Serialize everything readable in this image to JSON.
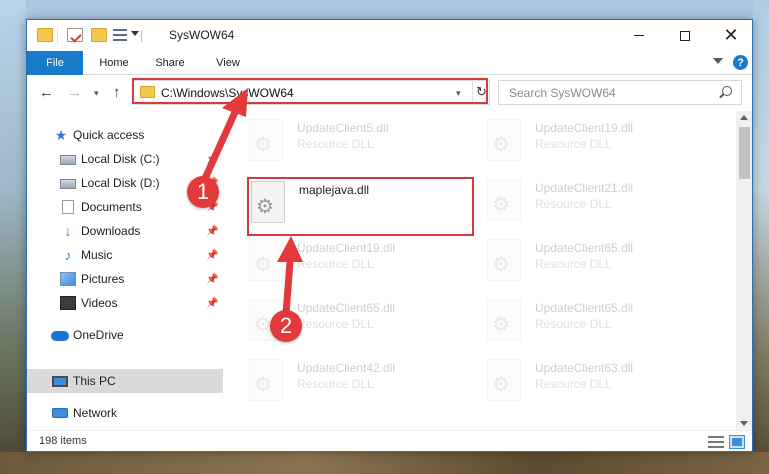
{
  "window": {
    "title": "SysWOW64",
    "minimize_symbol": "",
    "close_symbol": "✕"
  },
  "ribbon": {
    "tabs": [
      "File",
      "Home",
      "Share",
      "View"
    ],
    "help": "?"
  },
  "navigation": {
    "back": "←",
    "forward": "→",
    "recent": "▾",
    "up": "↑",
    "address": "C:\\Windows\\SysWOW64",
    "address_dropdown": "▾",
    "refresh": "↻",
    "search_placeholder": "Search SysWOW64"
  },
  "sidebar": {
    "items": [
      {
        "label": "Quick access",
        "icon": "star-icon",
        "pinned": false
      },
      {
        "label": "Local Disk (C:)",
        "icon": "disk-icon",
        "pinned": true
      },
      {
        "label": "Local Disk (D:)",
        "icon": "disk-icon",
        "pinned": true
      },
      {
        "label": "Documents",
        "icon": "documents-icon",
        "pinned": true
      },
      {
        "label": "Downloads",
        "icon": "download-icon",
        "pinned": true
      },
      {
        "label": "Music",
        "icon": "music-icon",
        "pinned": true
      },
      {
        "label": "Pictures",
        "icon": "pictures-icon",
        "pinned": true
      },
      {
        "label": "Videos",
        "icon": "video-icon",
        "pinned": true
      },
      {
        "label": "OneDrive",
        "icon": "cloud-icon",
        "pinned": false
      },
      {
        "label": "This PC",
        "icon": "pc-icon",
        "pinned": false,
        "selected": true
      },
      {
        "label": "Network",
        "icon": "network-icon",
        "pinned": false
      }
    ],
    "pin_glyph": "📌"
  },
  "files": [
    {
      "name": "UpdateClient5.dll",
      "type": "Resource DLL",
      "faded": true
    },
    {
      "name": "UpdateClient19.dll",
      "type": "Resource DLL",
      "faded": true
    },
    {
      "name": "maplejava.dll",
      "type": "",
      "faded": false
    },
    {
      "name": "UpdateClient21.dll",
      "type": "Resource DLL",
      "faded": true
    },
    {
      "name": "UpdateClient19.dll",
      "type": "Resource DLL",
      "faded": true
    },
    {
      "name": "UpdateClient65.dll",
      "type": "Resource DLL",
      "faded": true
    },
    {
      "name": "UpdateClient65.dll",
      "type": "Resource DLL",
      "faded": true
    },
    {
      "name": "UpdateClient65.dll",
      "type": "Resource DLL",
      "faded": true
    },
    {
      "name": "UpdateClient42.dll",
      "type": "Resource DLL",
      "faded": true
    },
    {
      "name": "UpdateClient63.dll",
      "type": "Resource DLL",
      "faded": true
    }
  ],
  "status": {
    "item_count": "198 items"
  },
  "annotations": {
    "step1": "1",
    "step2": "2",
    "color": "#e23a3a"
  }
}
